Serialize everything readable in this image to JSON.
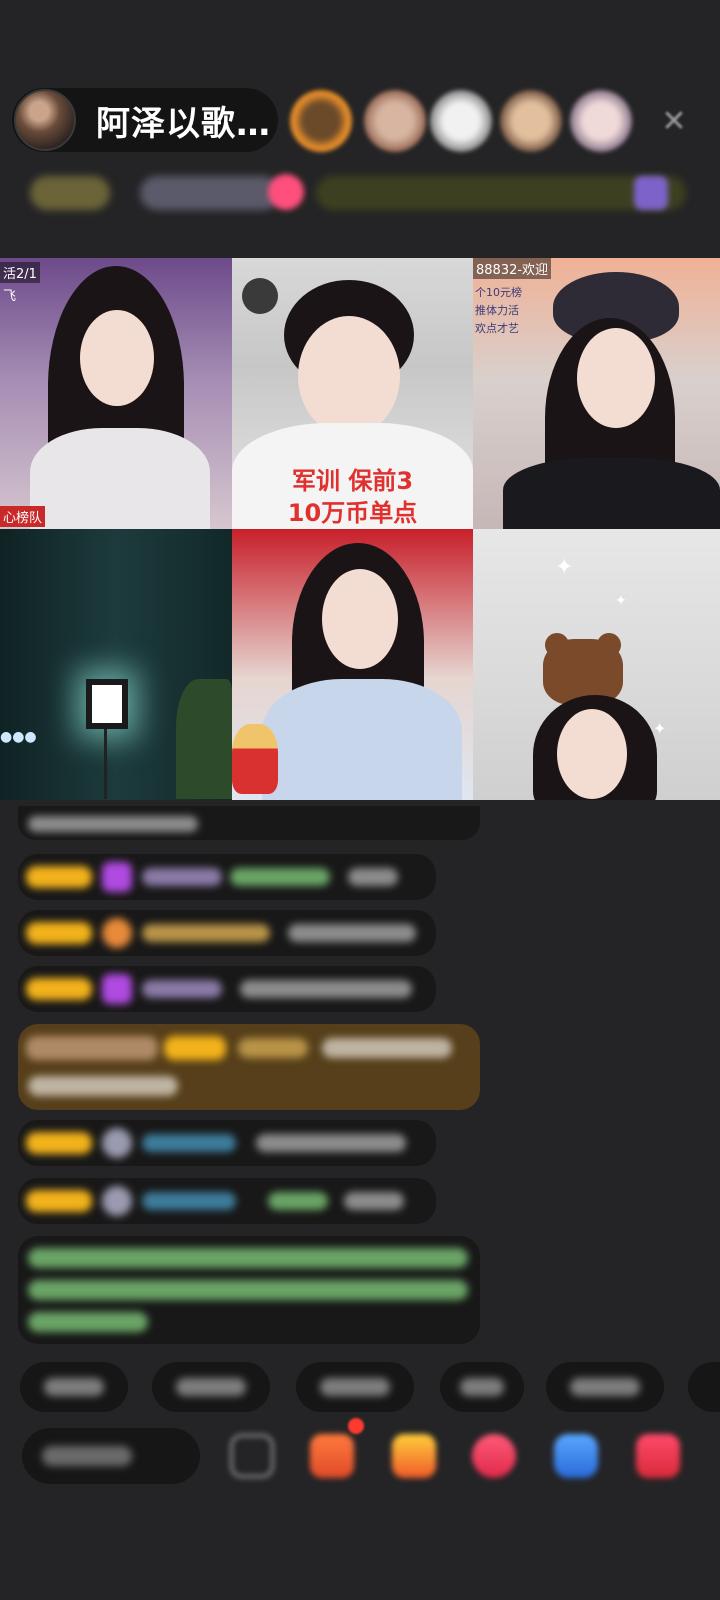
{
  "header": {
    "host_name": "阿泽以歌…",
    "close_icon": "close-icon",
    "viewer_avatar_colors": [
      "#e08a2a",
      "#9a6b58",
      "#d8d8d8",
      "#b58c6a",
      "#c4b2c4"
    ]
  },
  "video_tiles": [
    {
      "id": "top-left",
      "tag": "活2/1",
      "tag2": "飞",
      "bottom_tag": "心榜队"
    },
    {
      "id": "top-center",
      "overlay_line1": "军训 保前3",
      "overlay_line2": "10万币单点"
    },
    {
      "id": "top-right",
      "tag": "88832-欢迎",
      "side_lines": [
        "个10元榜",
        "推体力活",
        "欢点才艺"
      ]
    },
    {
      "id": "bottom-left",
      "icon": "studio-light-icon"
    },
    {
      "id": "bottom-center",
      "icon": "god-of-wealth-icon"
    },
    {
      "id": "bottom-right",
      "icon": "bear-hat-icon"
    }
  ],
  "colors": {
    "background": "#242426",
    "badge": "#f2b21b",
    "overlay_text": "#e0312f",
    "close_badge": "#ff3b30"
  }
}
